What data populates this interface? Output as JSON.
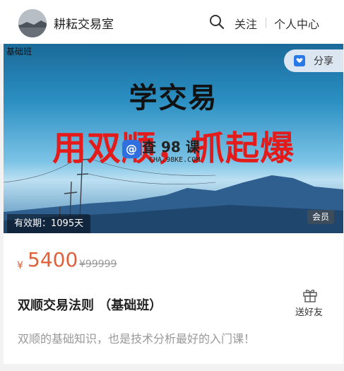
{
  "header": {
    "shop_name": "耕耘交易室",
    "follow_label": "关注",
    "profile_label": "个人中心"
  },
  "banner": {
    "corner_text": "基础班",
    "title": "学交易",
    "slogan": "用双顺，抓起爆",
    "watermark_text": "查 98 课",
    "watermark_domain": "CHA.98KE.COM",
    "share_label": "分享",
    "validity": "有效期：1095天",
    "member_badge": "会员"
  },
  "product": {
    "currency": "¥",
    "price": "5400",
    "original_price": "¥99999",
    "title": "双顺交易法则 （基础班）",
    "gift_label": "送好友",
    "description": "双顺的基础知识，也是技术分析最好的入门课！"
  },
  "colors": {
    "price": "#e0603a",
    "slogan": "#e41b1b",
    "share_icon": "#2979e6"
  }
}
